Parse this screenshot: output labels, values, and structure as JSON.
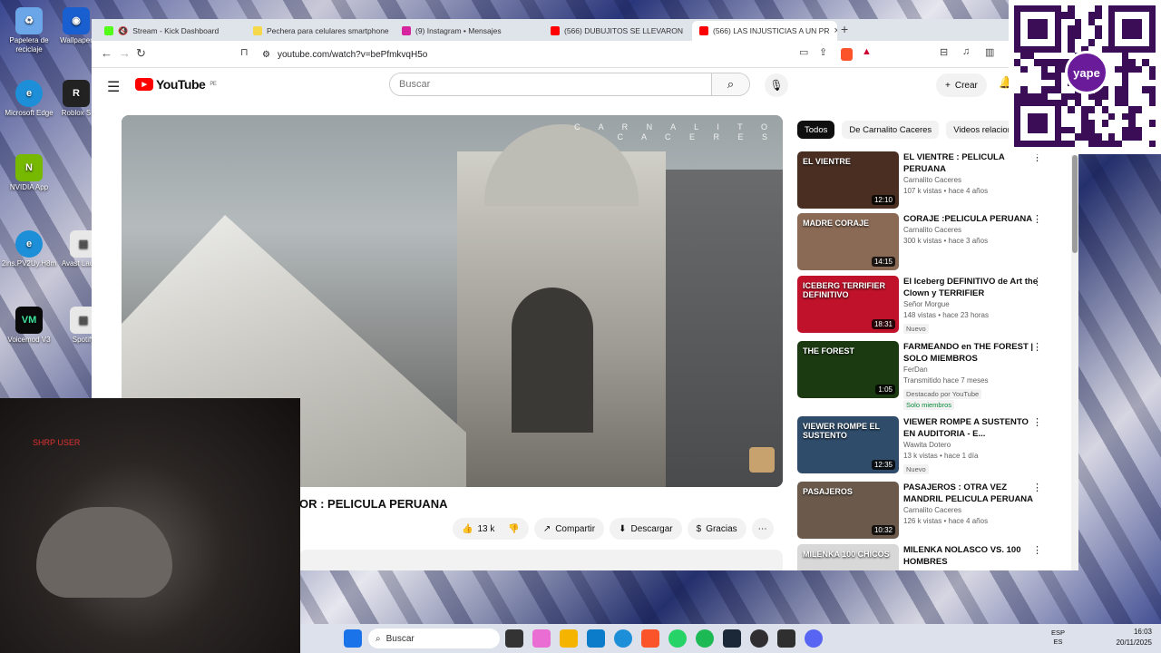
{
  "desktop": {
    "icons": [
      {
        "label": "Papelera de reciclaje",
        "color": "#6aa6e8"
      },
      {
        "label": "Wallpaper",
        "color": "#1a5fd0"
      },
      {
        "label": "Microsoft Edge",
        "color": "#1d8fd8"
      },
      {
        "label": "Roblox S",
        "color": "#222"
      },
      {
        "label": "NVIDIA App",
        "color": "#76b900"
      },
      {
        "label": "2ins.PV2Uy.H8m",
        "color": "#1d8fd8"
      },
      {
        "label": "Avast Launch",
        "color": "#e8e8e8"
      },
      {
        "label": "Voicemod V3",
        "color": "#0a0a0a"
      },
      {
        "label": "Spotify",
        "color": "#e8e8e8"
      }
    ]
  },
  "tabs": [
    {
      "title": "Stream - Kick Dashboard",
      "color": "#53fc18"
    },
    {
      "title": "Pechera para celulares smartphone",
      "color": "#f5d94a"
    },
    {
      "title": "(9) Instagram • Mensajes",
      "color": "#d6249f"
    },
    {
      "title": "(566) DUBUJITOS SE LLEVARON",
      "color": "#ff0000"
    },
    {
      "title": "(566) LAS INJUSTICIAS A UN PR",
      "color": "#ff0000"
    }
  ],
  "address": {
    "url": "youtube.com/watch?v=bePfmkvqH5o"
  },
  "youtube": {
    "logo": "YouTube",
    "region": "PE",
    "search_placeholder": "Buscar",
    "create": "Crear",
    "video_title": "OR : PELICULA PERUANA",
    "watermark": "C A R N A L I T O\nC A C E R E S",
    "likes": "13 k",
    "share": "Compartir",
    "download": "Descargar",
    "thanks": "Gracias"
  },
  "chips": [
    "Todos",
    "De Carnalito Caceres",
    "Videos relacion"
  ],
  "recommendations": [
    {
      "title": "EL VIENTRE : PELICULA PERUANA",
      "channel": "Carnalito Caceres",
      "meta": "107 k vistas • hace 4 años",
      "duration": "12:10",
      "thumb_text": "EL VIENTRE",
      "thumb_color": "#4a2e22",
      "badge": ""
    },
    {
      "title": "CORAJE :PELICULA PERUANA",
      "channel": "Carnalito Caceres",
      "meta": "300 k vistas • hace 3 años",
      "duration": "14:15",
      "thumb_text": "MADRE CORAJE",
      "thumb_color": "#8a6a55",
      "badge": ""
    },
    {
      "title": "El Iceberg DEFINITIVO de Art the Clown y TERRIFIER",
      "channel": "Señor Morgue",
      "meta": "148 vistas • hace 23 horas",
      "duration": "18:31",
      "thumb_text": "ICEBERG TERRIFIER DEFINITIVO",
      "thumb_color": "#c0122a",
      "badge": "Nuevo"
    },
    {
      "title": "FARMEANDO en THE FOREST | SOLO MIEMBROS",
      "channel": "FerDan",
      "meta": "Transmitido hace 7 meses",
      "duration": "1:05",
      "thumb_text": "THE FOREST",
      "thumb_color": "#1b3a12",
      "badge": "Destacado por YouTube",
      "extra": "Solo miembros"
    },
    {
      "title": "VIEWER ROMPE A SUSTENTO EN AUDITORIA - E...",
      "channel": "Wawita Dotero",
      "meta": "13 k vistas • hace 1 día",
      "duration": "12:35",
      "thumb_text": "VIEWER ROMPE EL SUSTENTO",
      "thumb_color": "#2f4c6a",
      "badge": "Nuevo"
    },
    {
      "title": "PASAJEROS : OTRA VEZ MANDRIL PELICULA PERUANA",
      "channel": "Carnalito Caceres",
      "meta": "126 k vistas • hace 4 años",
      "duration": "10:32",
      "thumb_text": "PASAJEROS",
      "thumb_color": "#6b5a4c",
      "badge": ""
    },
    {
      "title": "MILENKA NOLASCO VS. 100 HOMBRES",
      "channel": "",
      "meta": "",
      "duration": "",
      "thumb_text": "MILENKA 100 CHICOS",
      "thumb_color": "#d8d8d8",
      "badge": ""
    }
  ],
  "webcam": {
    "label": "SHRP USER"
  },
  "qr": {
    "brand": "yape"
  },
  "taskbar": {
    "search": "Buscar",
    "lang1": "ESP",
    "lang2": "ES",
    "time": "16:03",
    "date": "20/11/2025"
  }
}
